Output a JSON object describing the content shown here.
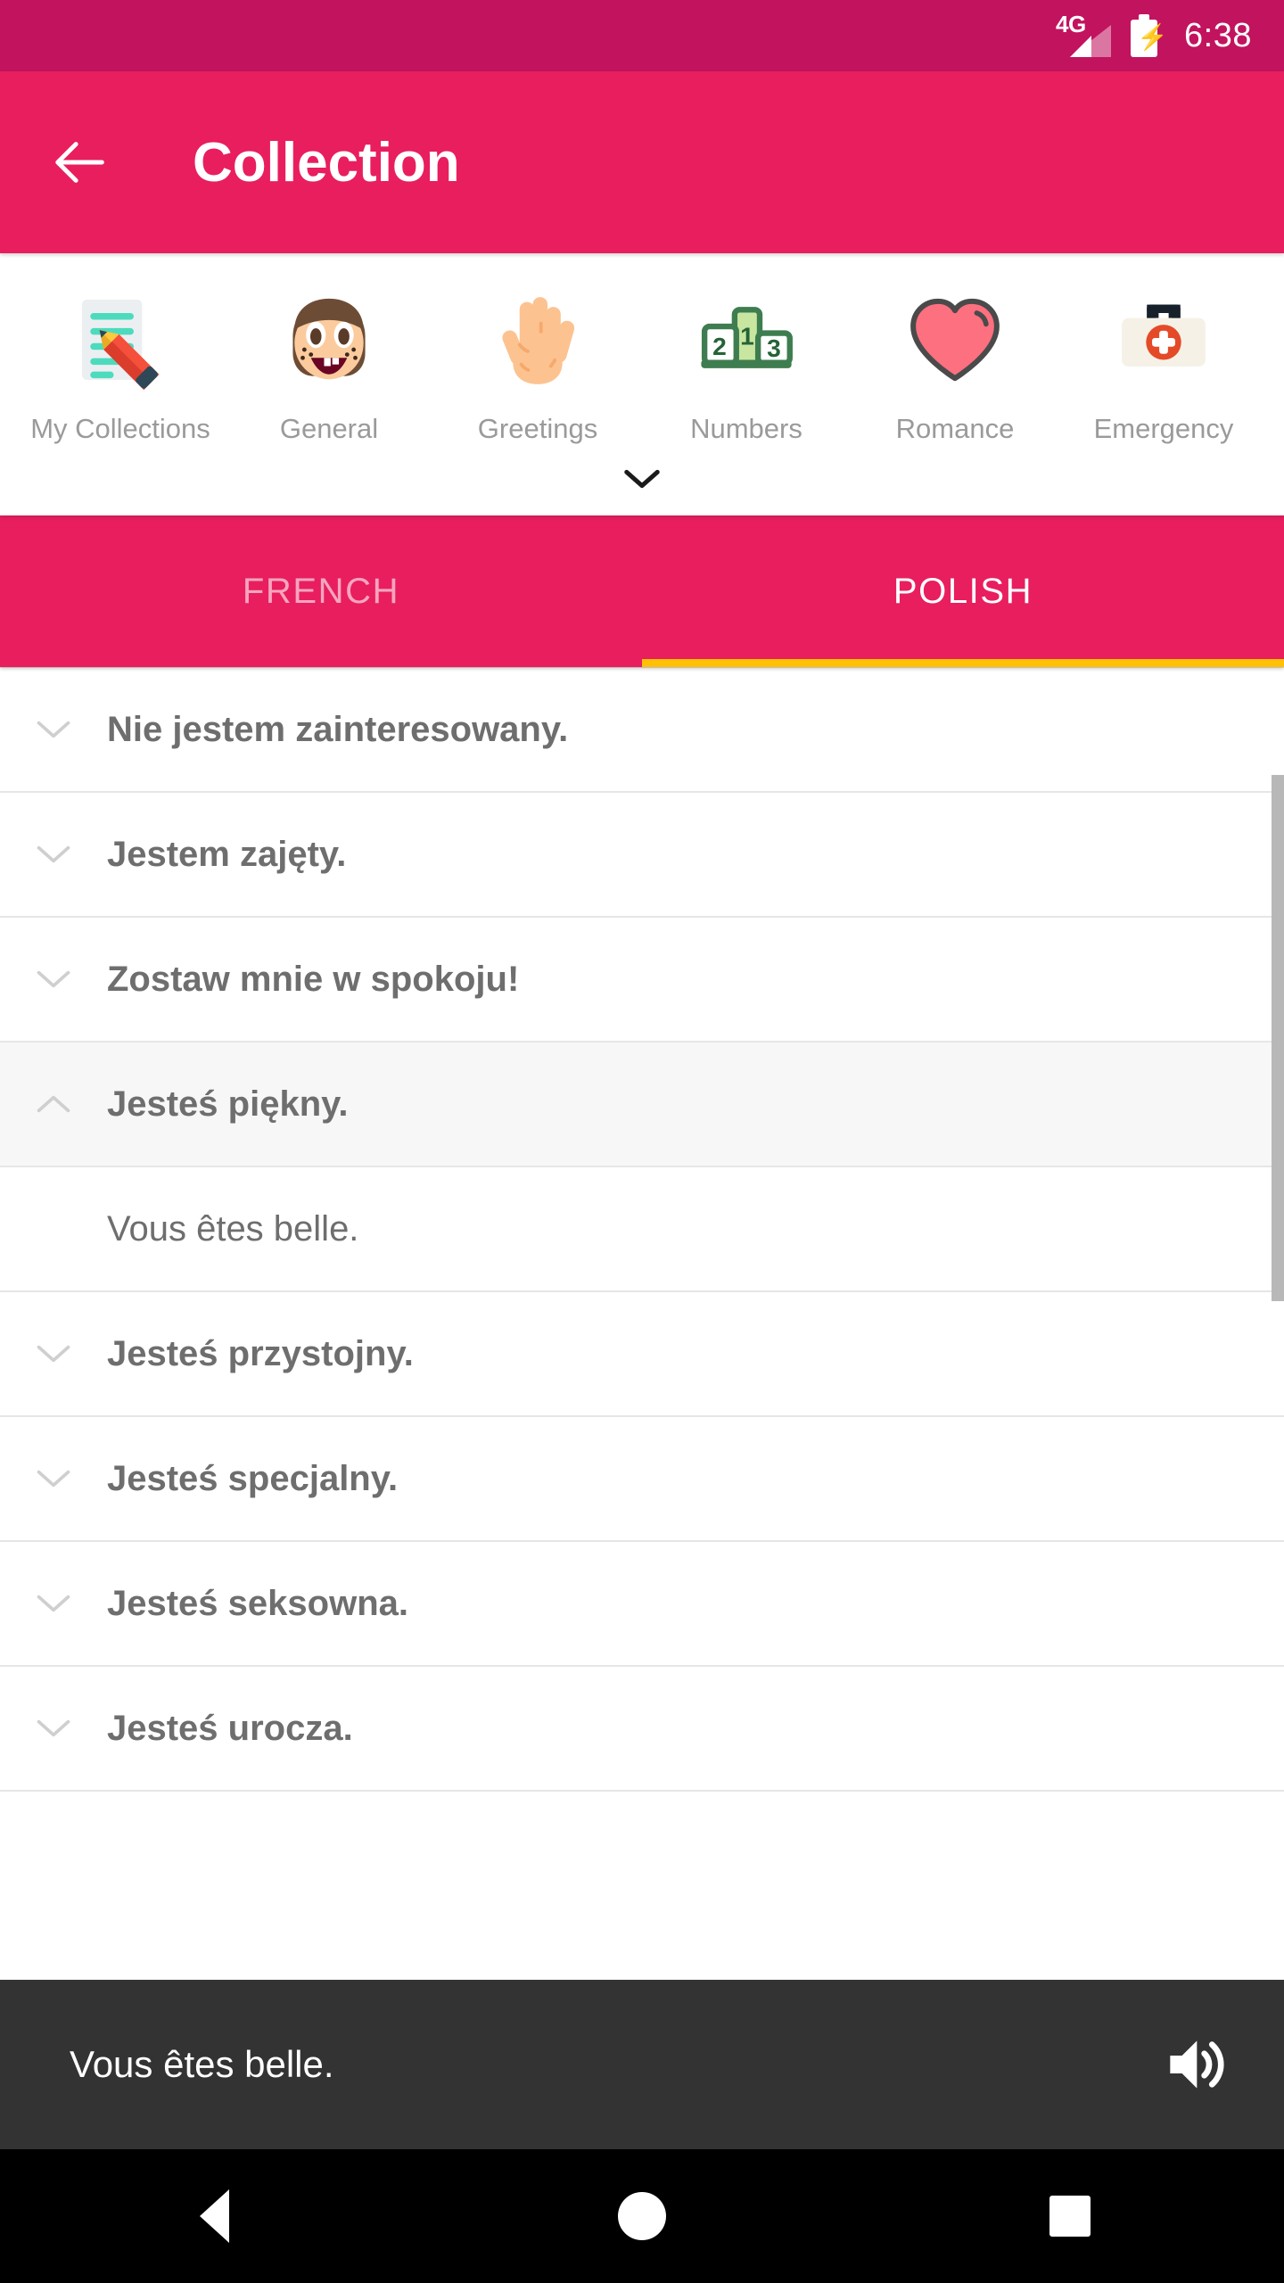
{
  "status_bar": {
    "network_label": "4G",
    "time": "6:38",
    "signal_icon": "signal-4g-icon",
    "battery_icon": "battery-charging-icon"
  },
  "app_bar": {
    "back_icon": "back-arrow-icon",
    "title": "Collection"
  },
  "categories": {
    "expand_icon": "chevron-down-icon",
    "items": [
      {
        "label": "My Collections",
        "icon": "memo-pencil-icon"
      },
      {
        "label": "General",
        "icon": "smiling-face-icon"
      },
      {
        "label": "Greetings",
        "icon": "raised-hand-icon"
      },
      {
        "label": "Numbers",
        "icon": "podium-123-icon"
      },
      {
        "label": "Romance",
        "icon": "heart-icon"
      },
      {
        "label": "Emergency",
        "icon": "first-aid-kit-icon"
      }
    ]
  },
  "tabs": {
    "items": [
      {
        "label": "FRENCH",
        "active": false
      },
      {
        "label": "POLISH",
        "active": true
      }
    ],
    "indicator_color": "#ffc005"
  },
  "phrase_list": {
    "collapsed_icon": "chevron-down-icon",
    "expanded_icon": "chevron-up-icon",
    "rows": [
      {
        "text": "Nie jestem zainteresowany.",
        "expanded": false,
        "type": "phrase"
      },
      {
        "text": "Jestem zajęty.",
        "expanded": false,
        "type": "phrase"
      },
      {
        "text": "Zostaw mnie w spokoju!",
        "expanded": false,
        "type": "phrase"
      },
      {
        "text": "Jesteś piękny.",
        "expanded": true,
        "type": "phrase"
      },
      {
        "text": "Vous êtes belle.",
        "expanded": false,
        "type": "translation"
      },
      {
        "text": "Jesteś przystojny.",
        "expanded": false,
        "type": "phrase"
      },
      {
        "text": "Jesteś specjalny.",
        "expanded": false,
        "type": "phrase"
      },
      {
        "text": "Jesteś seksowna.",
        "expanded": false,
        "type": "phrase"
      },
      {
        "text": "Jesteś urocza.",
        "expanded": false,
        "type": "phrase"
      }
    ]
  },
  "player_bar": {
    "text": "Vous êtes belle.",
    "speaker_icon": "speaker-volume-icon"
  },
  "nav_bar": {
    "back_icon": "nav-back-triangle-icon",
    "home_icon": "nav-home-circle-icon",
    "recents_icon": "nav-recents-square-icon"
  },
  "colors": {
    "status_bar": "#c2135f",
    "app_bar": "#e81e5f",
    "tab_indicator": "#ffc005",
    "player_bar": "#333333",
    "expanded_row": "#f7f7f7"
  }
}
